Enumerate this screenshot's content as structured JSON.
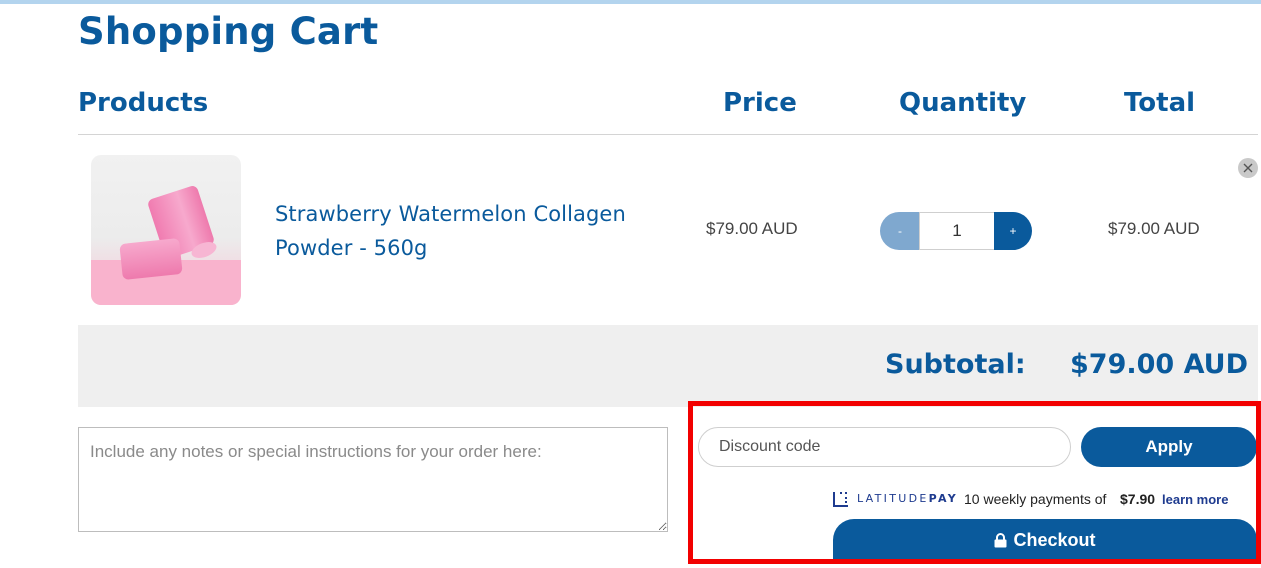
{
  "page": {
    "title": "Shopping Cart"
  },
  "table": {
    "headers": {
      "products": "Products",
      "price": "Price",
      "quantity": "Quantity",
      "total": "Total"
    }
  },
  "cart": {
    "items": [
      {
        "name": "Strawberry Watermelon Collagen Powder - 560g",
        "price": "$79.00 AUD",
        "quantity": "1",
        "total": "$79.00 AUD",
        "minus_label": "-",
        "plus_label": "+",
        "image_alt": "Strawberry Watermelon Collagen Powder cans"
      }
    ],
    "subtotal_label": "Subtotal:",
    "subtotal_value": "$79.00 AUD"
  },
  "notes": {
    "placeholder": "Include any notes or special instructions for your order here:"
  },
  "discount": {
    "placeholder": "Discount code",
    "apply_label": "Apply"
  },
  "latitude": {
    "brand_light": "LATITUDE",
    "brand_bold": "PAY",
    "text": "10 weekly payments of",
    "amount": "$7.90",
    "learn_more": "learn more"
  },
  "checkout": {
    "label": "Checkout"
  },
  "colors": {
    "brand_blue": "#0a5a9c",
    "highlight_red": "#f20000",
    "band_gray": "#efefef",
    "latitude_navy": "#1e3b8f"
  },
  "icons": {
    "remove": "close-icon",
    "lock": "lock-icon",
    "latitude": "latitude-logo-icon"
  }
}
